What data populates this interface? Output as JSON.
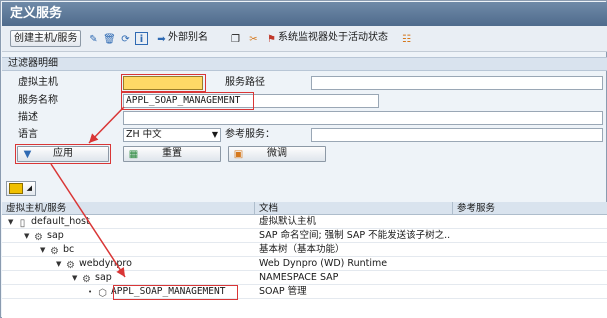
{
  "window": {
    "title": "定义服务"
  },
  "toolbar": {
    "create_host_service": "创建主机/服务",
    "external_alias": "外部别名",
    "activate_monitor": "系统监视器处于活动状态"
  },
  "filter": {
    "section_title": "过滤器明细",
    "virtual_host_label": "虚拟主机",
    "virtual_host_value": "",
    "service_path_label": "服务路径",
    "service_path_value": "",
    "service_name_label": "服务名称",
    "service_name_value": "APPL_SOAP_MANAGEMENT",
    "description_label": "描述",
    "description_value": "",
    "language_label": "语言",
    "language_value": "ZH 中文",
    "ref_service_label": "参考服务：",
    "ref_service_value": ""
  },
  "buttons": {
    "apply": "应用",
    "reset": "重置",
    "fine_tune": "微调"
  },
  "table": {
    "headers": [
      "虚拟主机/服务",
      "文档",
      "参考服务"
    ],
    "rows": [
      {
        "name": "default_host",
        "doc": "虚拟默认主机"
      },
      {
        "name": "sap",
        "doc": "SAP 命名空间; 强制 SAP 不能发送该子树之..."
      },
      {
        "name": "bc",
        "doc": "基本树（基本功能）"
      },
      {
        "name": "webdynpro",
        "doc": "Web Dynpro (WD) Runtime"
      },
      {
        "name": "sap",
        "doc": "NAMESPACE SAP"
      },
      {
        "name": "APPL_SOAP_MANAGEMENT",
        "doc": "SOAP 管理"
      }
    ]
  },
  "colors": {
    "highlight": "#d93636",
    "title_bar": "#5a7698"
  }
}
